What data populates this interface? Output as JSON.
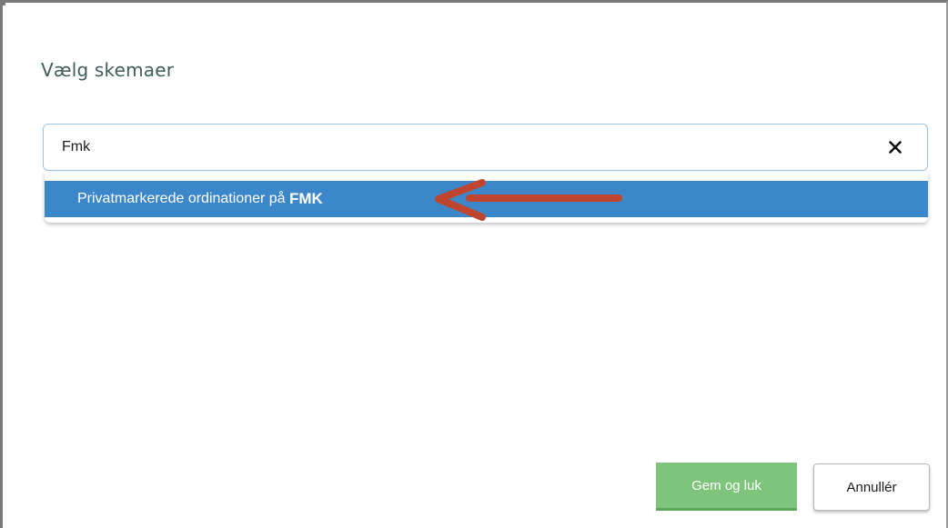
{
  "dialog": {
    "title": "Vælg skemaer"
  },
  "search": {
    "value": "Fmk",
    "clear_icon": "close-icon"
  },
  "dropdown": {
    "options": [
      {
        "text_before": "Privatmarkerede ordinationer på ",
        "text_match": "FMK"
      }
    ]
  },
  "annotation": {
    "arrow_color": "#c0452f"
  },
  "footer": {
    "save_label": "Gem og luk",
    "cancel_label": "Annullér"
  },
  "colors": {
    "title": "#3f5e5b",
    "highlight": "#3c87c9",
    "save_button": "#7ec47b",
    "focus_border": "#9cc3e6"
  }
}
